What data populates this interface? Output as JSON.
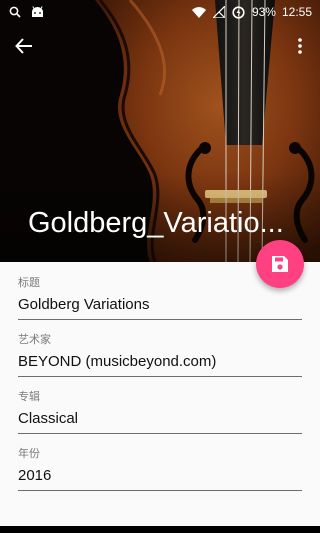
{
  "status_bar": {
    "left_icons": [
      "search-icon",
      "android-icon"
    ],
    "battery_percent": "93%",
    "time": "12:55"
  },
  "toolbar": {
    "back_icon": "arrow-back-icon",
    "more_icon": "more-vert-icon"
  },
  "header": {
    "title": "Goldberg_Variatio..."
  },
  "fab": {
    "icon": "save-icon",
    "color": "#ff4081"
  },
  "form": {
    "fields": [
      {
        "label": "标题",
        "value": "Goldberg Variations"
      },
      {
        "label": "艺术家",
        "value": "BEYOND (musicbeyond.com)"
      },
      {
        "label": "专辑",
        "value": "Classical"
      },
      {
        "label": "年份",
        "value": "2016"
      }
    ]
  }
}
